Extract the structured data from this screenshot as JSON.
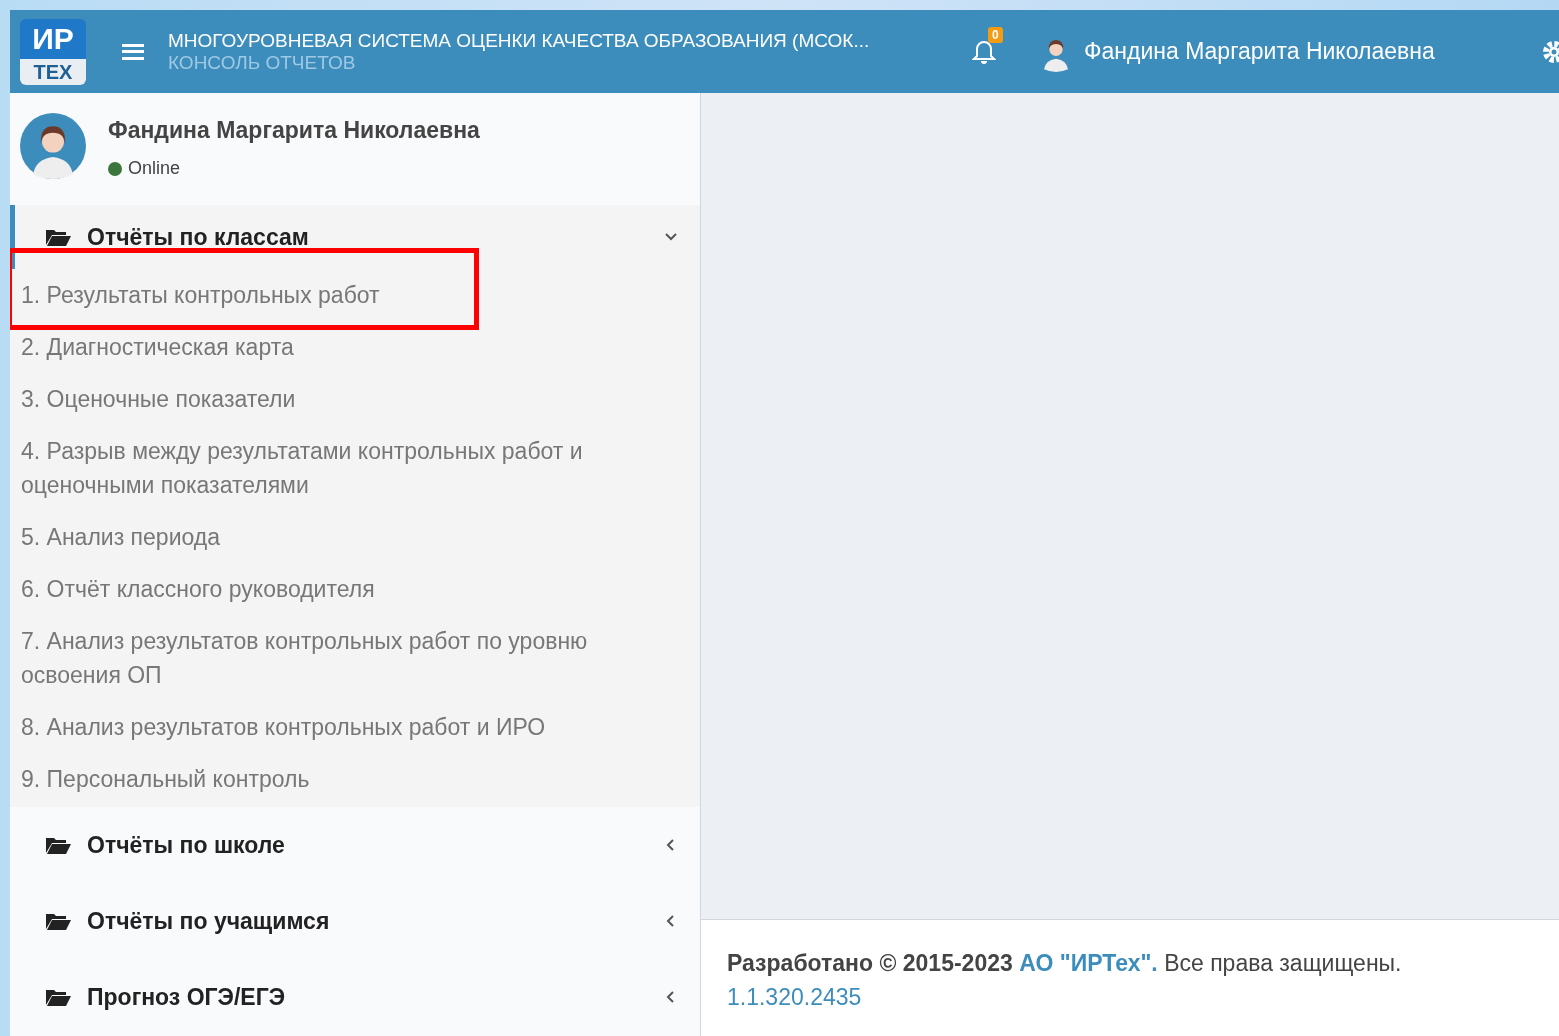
{
  "header": {
    "logo_top": "ИР",
    "logo_bottom": "TEX",
    "title": "МНОГОУРОВНЕВАЯ СИСТЕМА ОЦЕНКИ КАЧЕСТВА ОБРАЗОВАНИЯ (МСОК...",
    "subtitle": "КОНСОЛЬ ОТЧЕТОВ",
    "notification_count": "0",
    "user_name": "Фандина Маргарита Николаевна"
  },
  "user_panel": {
    "name": "Фандина Маргарита Николаевна",
    "status": "Online"
  },
  "menu": [
    {
      "label": "Отчёты по классам",
      "expanded": true,
      "items": [
        {
          "label": "1. Результаты контрольных работ",
          "highlighted": true
        },
        {
          "label": "2. Диагностическая карта",
          "highlighted": false
        },
        {
          "label": "3. Оценочные показатели",
          "highlighted": false
        },
        {
          "label": "4. Разрыв между результатами контрольных работ и оценочными показателями",
          "highlighted": false
        },
        {
          "label": "5. Анализ периода",
          "highlighted": false
        },
        {
          "label": "6. Отчёт классного руководителя",
          "highlighted": false
        },
        {
          "label": "7. Анализ результатов контрольных работ по уровню освоения ОП",
          "highlighted": false
        },
        {
          "label": "8. Анализ результатов контрольных работ и ИРО",
          "highlighted": false
        },
        {
          "label": "9. Персональный контроль",
          "highlighted": false
        }
      ]
    },
    {
      "label": "Отчёты по школе",
      "expanded": false
    },
    {
      "label": "Отчёты по учащимся",
      "expanded": false
    },
    {
      "label": "Прогноз ОГЭ/ЕГЭ",
      "expanded": false
    }
  ],
  "footer": {
    "copyright": "Разработано © 2015-2023",
    "company_link": "АО \"ИРТех\".",
    "rights": "Все права защищены.",
    "version": "1.1.320.2435"
  }
}
